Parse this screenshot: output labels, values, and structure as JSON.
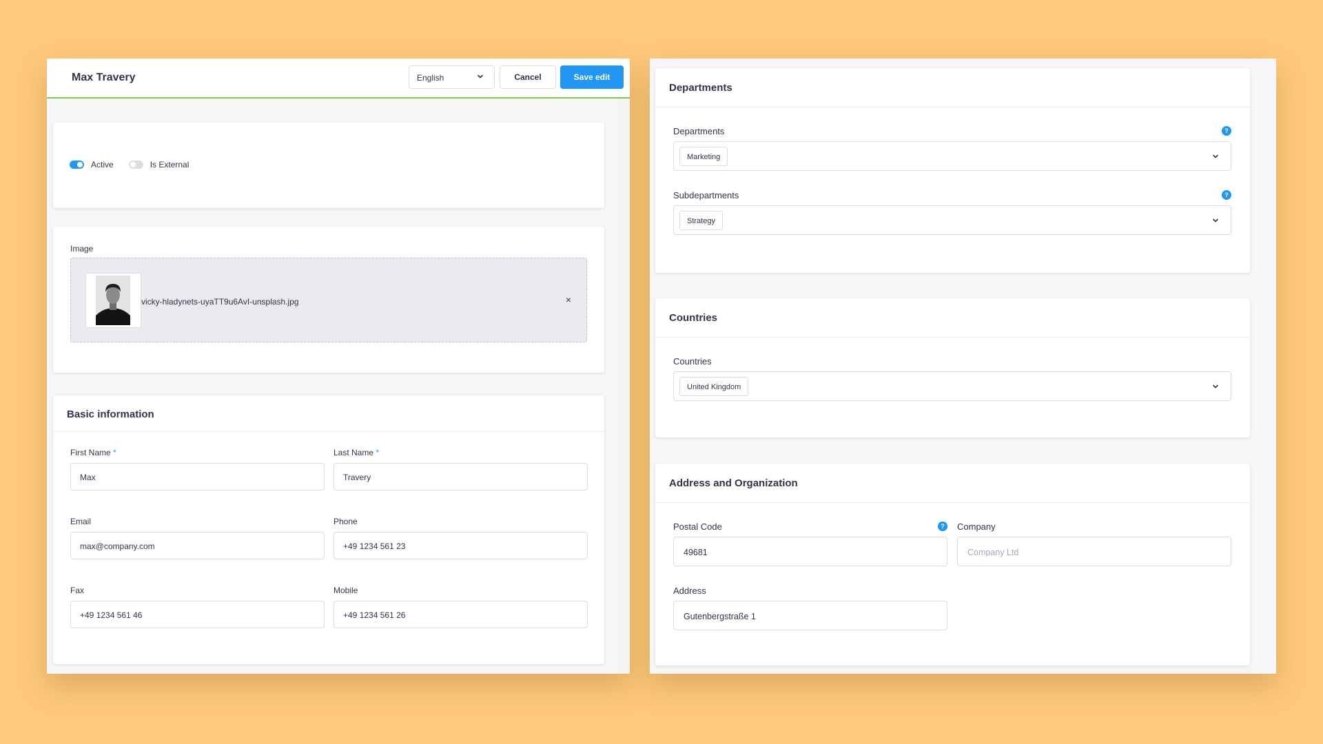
{
  "header": {
    "title": "Max Travery",
    "language": "English",
    "cancel_label": "Cancel",
    "save_label": "Save edit"
  },
  "toggles": {
    "active_label": "Active",
    "active_on": true,
    "external_label": "Is External",
    "external_on": false
  },
  "image": {
    "label": "Image",
    "file_name": "vicky-hladynets-uyaTT9u6AvI-unsplash.jpg",
    "remove_symbol": "×"
  },
  "basic": {
    "title": "Basic information",
    "required_mark": "*",
    "first_name_label": "First Name",
    "first_name": "Max",
    "last_name_label": "Last Name",
    "last_name": "Travery",
    "email_label": "Email",
    "email": "max@company.com",
    "phone_label": "Phone",
    "phone": "+49 1234 561 23",
    "fax_label": "Fax",
    "fax": "+49 1234 561 46",
    "mobile_label": "Mobile",
    "mobile": "+49 1234 561 26"
  },
  "departments": {
    "title": "Departments",
    "departments_label": "Departments",
    "department_tag": "Marketing",
    "subdepartments_label": "Subdepartments",
    "subdepartment_tag": "Strategy",
    "help_symbol": "?"
  },
  "countries": {
    "title": "Countries",
    "countries_label": "Countries",
    "country_tag": "United Kingdom"
  },
  "address": {
    "title": "Address and Organization",
    "postal_code_label": "Postal Code",
    "postal_code": "49681",
    "company_label": "Company",
    "company_placeholder": "Company Ltd",
    "address_label": "Address",
    "address": "Gutenbergstraße 1"
  },
  "colors": {
    "primary": "#2196f3",
    "header_accent": "#7ecb3f",
    "background": "#fec97b"
  }
}
